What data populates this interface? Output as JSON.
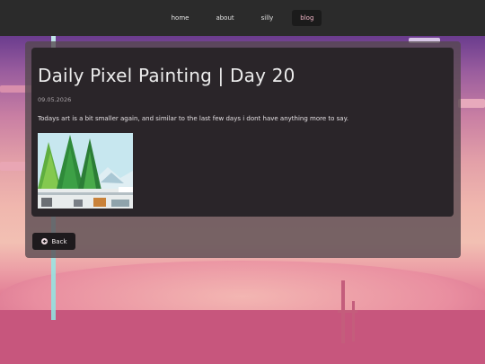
{
  "nav": {
    "items": [
      {
        "label": "home"
      },
      {
        "label": "about"
      },
      {
        "label": "silly"
      },
      {
        "label": "blog"
      }
    ],
    "active": "blog"
  },
  "post": {
    "title": "Daily Pixel Painting | Day 20",
    "date": "09.05.2026",
    "body": "Todays art is a bit smaller again, and similar to the last few days i dont have anything more to say.",
    "image_icon": "pixel-art-painting-trees"
  },
  "back_button": {
    "label": "Back",
    "icon": "arrow-left-circle-icon"
  },
  "colors": {
    "nav_bg": "#2b2b2b",
    "active_link": "#f2b6c8",
    "card_bg": "#2a2529",
    "accent_sky": "#c97fa3"
  }
}
